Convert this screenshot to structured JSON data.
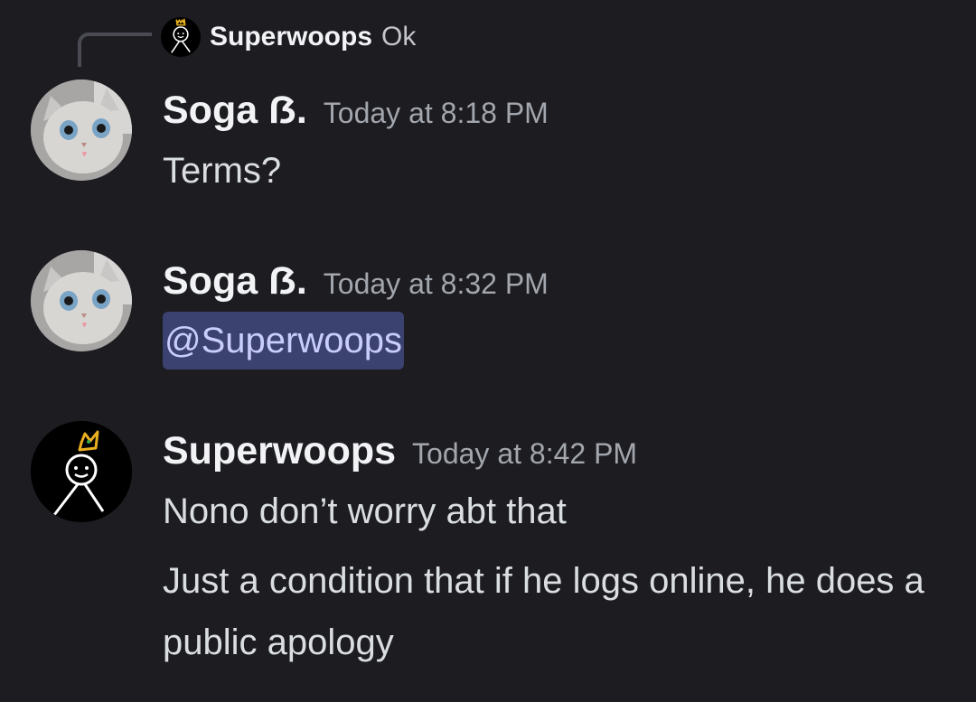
{
  "reply": {
    "author": "Superwoops",
    "text": "Ok"
  },
  "messages": [
    {
      "author": "Soga ẞ.",
      "timestamp": "Today at 8:18 PM",
      "lines": [
        "Terms?"
      ]
    },
    {
      "author": "Soga ẞ.",
      "timestamp": "Today at 8:32 PM",
      "mention": "@Superwoops"
    },
    {
      "author": "Superwoops",
      "timestamp": "Today at 8:42 PM",
      "lines": [
        "Nono don’t worry abt that",
        "Just a condition that if he logs online, he does a public apology"
      ]
    }
  ],
  "colors": {
    "background": "#1c1c21",
    "mention_bg": "#3c4270",
    "mention_text": "#c9cdfb",
    "crown": "#e8b020"
  },
  "icons": {
    "reply_avatar": "crown-stick-figure-icon",
    "cat_avatar": "cat-avatar-icon"
  }
}
